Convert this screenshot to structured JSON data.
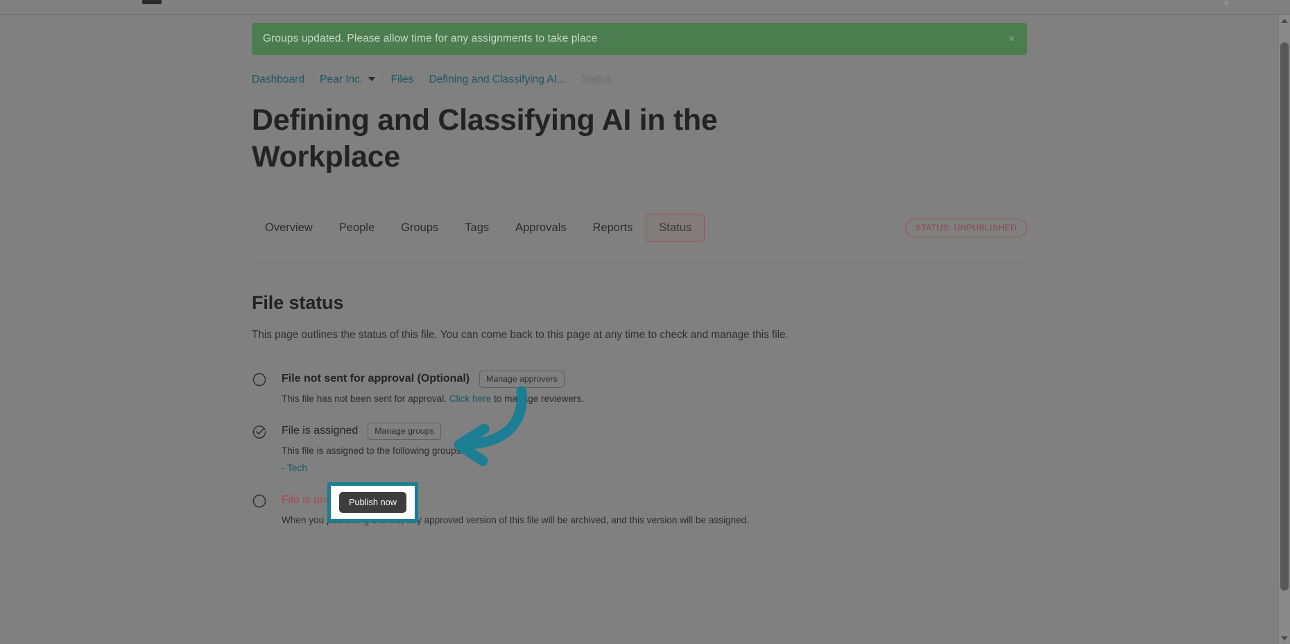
{
  "alert": {
    "message": "Groups updated. Please allow time for any assignments to take place",
    "close_label": "×",
    "color": "#4c7d4f"
  },
  "breadcrumb": {
    "separator": "/",
    "items": [
      {
        "label": "Dashboard",
        "muted": false,
        "has_caret": false
      },
      {
        "label": "Pear Inc.",
        "muted": false,
        "has_caret": true
      },
      {
        "label": "Files",
        "muted": false,
        "has_caret": false
      },
      {
        "label": "Defining and Classifying AI...",
        "muted": false,
        "has_caret": false
      },
      {
        "label": "Status",
        "muted": true,
        "has_caret": false
      }
    ]
  },
  "page": {
    "title": "Defining and Classifying AI in the Workplace"
  },
  "tabs": {
    "items": [
      {
        "label": "Overview",
        "active": false
      },
      {
        "label": "People",
        "active": false
      },
      {
        "label": "Groups",
        "active": false
      },
      {
        "label": "Tags",
        "active": false
      },
      {
        "label": "Approvals",
        "active": false
      },
      {
        "label": "Reports",
        "active": false
      },
      {
        "label": "Status",
        "active": true
      }
    ],
    "status_badge": "STATUS: UNPUBLISHED",
    "status_badge_color": "#8d434d"
  },
  "file_status": {
    "heading": "File status",
    "description": "This page outlines the status of this file. You can come back to this page at any time to check and manage this file.",
    "items": [
      {
        "icon": "circle-empty-icon",
        "label": "File not sent for approval (Optional)",
        "label_style": "bold",
        "button": "Manage approvers",
        "desc_before": "This file has not been sent for approval. ",
        "desc_link": "Click here",
        "desc_after": " to manage reviewers.",
        "sub": ""
      },
      {
        "icon": "circle-check-icon",
        "label": "File is assigned",
        "label_style": "plain",
        "button": "Manage groups",
        "desc_before": "This file is assigned to the following groups:",
        "desc_link": "",
        "desc_after": "",
        "sub": "- Tech"
      },
      {
        "icon": "circle-empty-icon",
        "label": "File is unpublished",
        "label_style": "danger",
        "button": "Publish now",
        "desc_before": "When you publishing this file, any approved version of this file will be archived, and this version will be assigned.",
        "desc_link": "",
        "desc_after": "",
        "sub": ""
      }
    ]
  },
  "annotation": {
    "highlight_color": "#1b7e92",
    "arrow_color": "#1b7e92",
    "target_label": "Publish now"
  }
}
